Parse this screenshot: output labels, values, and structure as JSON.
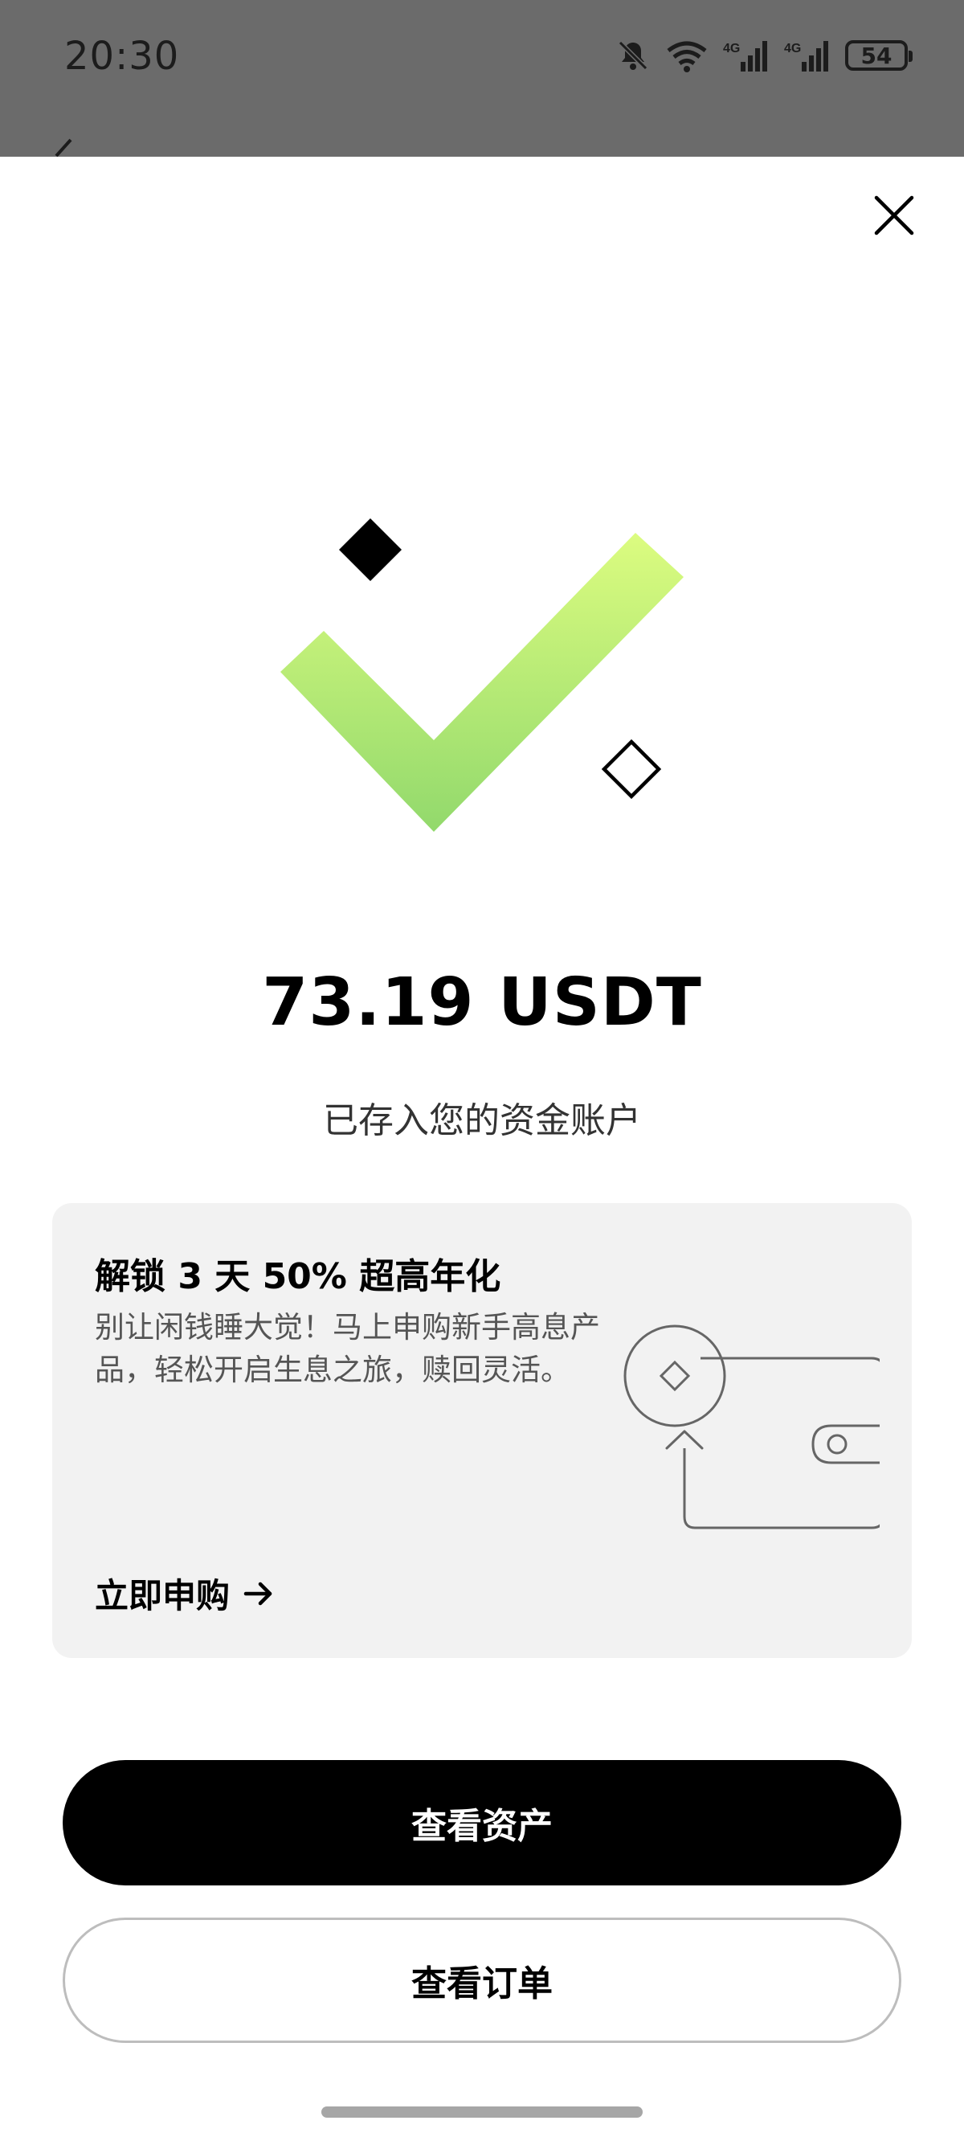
{
  "status_bar": {
    "time": "20:30",
    "battery": "54",
    "icons": [
      "bell-muted-icon",
      "wifi-icon",
      "signal-4g-icon",
      "signal-4g-icon",
      "battery-icon"
    ],
    "network_labels": [
      "4G",
      "4G"
    ]
  },
  "close_icon": "close-icon",
  "result": {
    "amount": "73.19 USDT",
    "message": "已存入您的资金账户",
    "check_gradient": [
      "#dcfc80",
      "#92d96c"
    ]
  },
  "promo": {
    "title": "解锁 3 天 50% 超高年化",
    "description": "别让闲钱睡大觉！马上申购新手高息产品，轻松开启生息之旅，赎回灵活。",
    "link_label": "立即申购",
    "link_icon": "arrow-right-icon",
    "illustration_icon": "wallet-icon"
  },
  "actions": {
    "view_assets": "查看资产",
    "view_orders": "查看订单"
  }
}
